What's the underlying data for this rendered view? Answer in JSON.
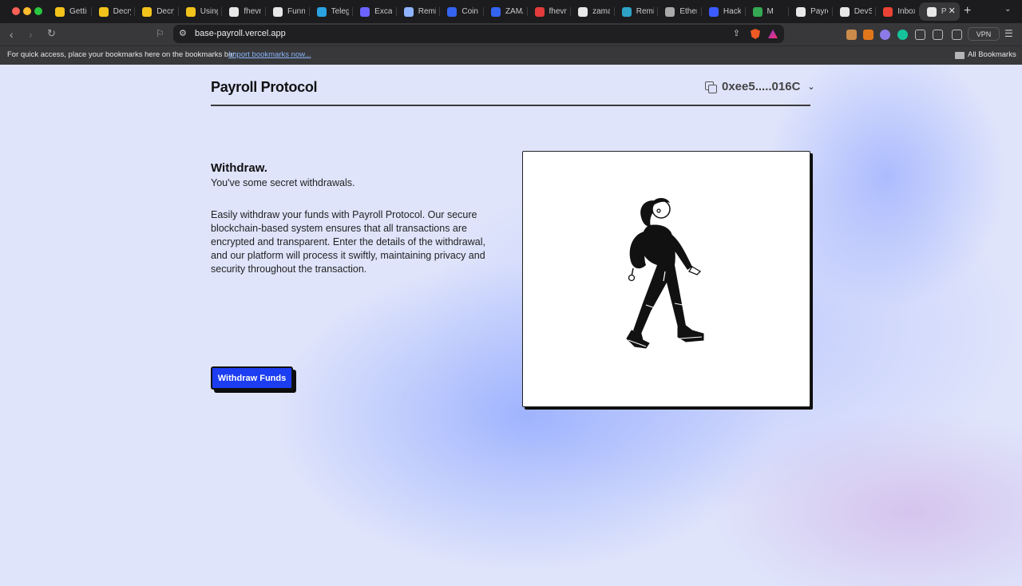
{
  "browser": {
    "tabs": [
      {
        "label": "Getting",
        "color": "#f2c31b"
      },
      {
        "label": "Decrypt",
        "color": "#f2c31b"
      },
      {
        "label": "Decrypt",
        "color": "#f2c31b"
      },
      {
        "label": "Using",
        "color": "#f2c31b"
      },
      {
        "label": "fhevm",
        "color": "#e8e8e8"
      },
      {
        "label": "Funny",
        "color": "#e8e8e8"
      },
      {
        "label": "Telegram",
        "color": "#2aa3e0"
      },
      {
        "label": "Excalidraw",
        "color": "#6c63ff"
      },
      {
        "label": "Remix",
        "color": "#8fb3ff"
      },
      {
        "label": "Coin",
        "color": "#3463f0"
      },
      {
        "label": "ZAMA",
        "color": "#3463f0"
      },
      {
        "label": "fhevm",
        "color": "#e23b3b"
      },
      {
        "label": "zama",
        "color": "#e8e8e8"
      },
      {
        "label": "Remix",
        "color": "#2fa3c7"
      },
      {
        "label": "Ether",
        "color": "#aaaaaa"
      },
      {
        "label": "Hack",
        "color": "#3b5bff"
      },
      {
        "label": "M",
        "color": "#34a853"
      },
      {
        "label": "Payroll",
        "color": "#e8e8e8"
      },
      {
        "label": "DevS",
        "color": "#e8e8e8"
      },
      {
        "label": "Inbox",
        "color": "#ea4335"
      }
    ],
    "active_tab": {
      "label": "P",
      "color": "#e8e8e8"
    },
    "url": "base-payroll.vercel.app",
    "vpn_label": "VPN",
    "bookmarks_hint": "For quick access, place your bookmarks here on the bookmarks bar.",
    "bookmarks_link": "Import bookmarks now...",
    "all_bookmarks": "All Bookmarks"
  },
  "header": {
    "brand": "Payroll Protocol",
    "wallet_address": "0xee5.....016C"
  },
  "main": {
    "title": "Withdraw.",
    "subtitle": "You've some secret withdrawals.",
    "description": "Easily withdraw your funds with Payroll Protocol. Our secure blockchain-based system ensures that all transactions are encrypted and transparent. Enter the details of the withdrawal, and our platform will process it swiftly, maintaining privacy and security throughout the transaction.",
    "button_label": "Withdraw Funds"
  },
  "colors": {
    "accent": "#1c3df1",
    "page_background": "#dfe4fb"
  }
}
